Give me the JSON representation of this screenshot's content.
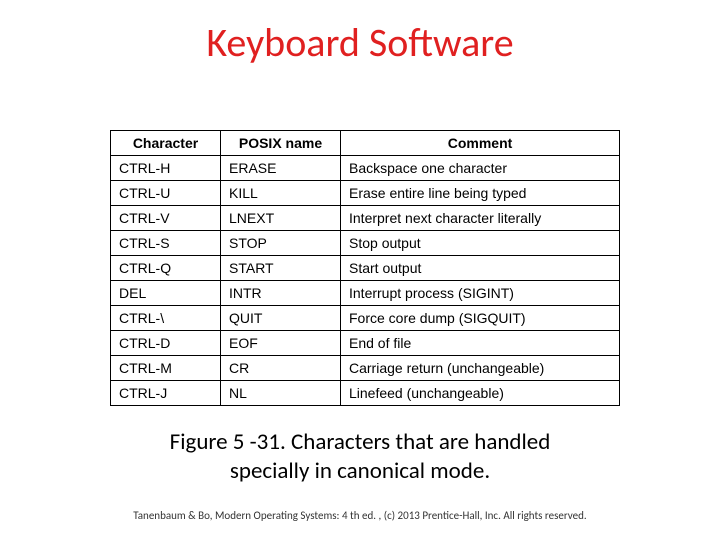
{
  "title": "Keyboard Software",
  "table": {
    "headers": [
      "Character",
      "POSIX name",
      "Comment"
    ],
    "rows": [
      [
        "CTRL-H",
        "ERASE",
        "Backspace one character"
      ],
      [
        "CTRL-U",
        "KILL",
        "Erase entire line being typed"
      ],
      [
        "CTRL-V",
        "LNEXT",
        "Interpret next character literally"
      ],
      [
        "CTRL-S",
        "STOP",
        "Stop output"
      ],
      [
        "CTRL-Q",
        "START",
        "Start output"
      ],
      [
        "DEL",
        "INTR",
        "Interrupt process (SIGINT)"
      ],
      [
        "CTRL-\\",
        "QUIT",
        "Force core dump (SIGQUIT)"
      ],
      [
        "CTRL-D",
        "EOF",
        "End of file"
      ],
      [
        "CTRL-M",
        "CR",
        "Carriage return (unchangeable)"
      ],
      [
        "CTRL-J",
        "NL",
        "Linefeed (unchangeable)"
      ]
    ]
  },
  "caption_line1": "Figure 5 -31. Characters that are handled",
  "caption_line2": "specially in canonical mode.",
  "footer": "Tanenbaum & Bo, Modern Operating Systems: 4 th ed. , (c) 2013 Prentice-Hall, Inc. All rights reserved."
}
